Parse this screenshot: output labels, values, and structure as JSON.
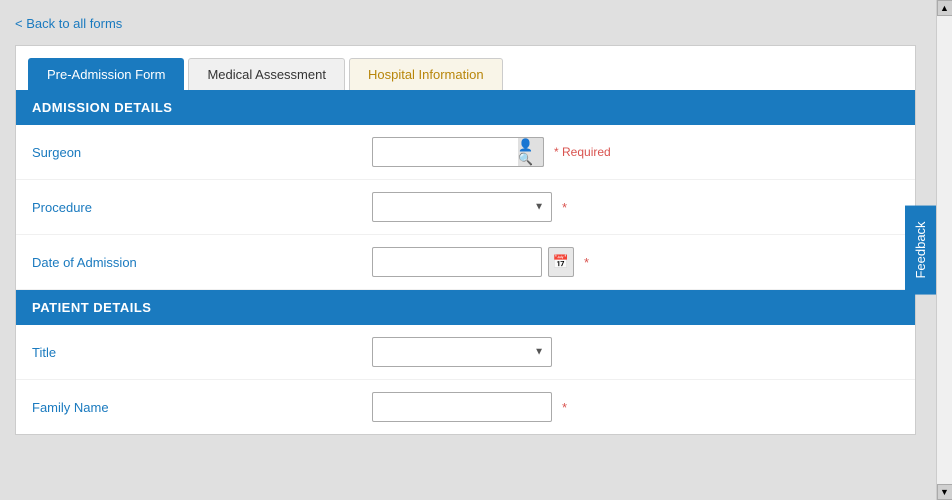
{
  "back_link": "< Back to all forms",
  "tabs": [
    {
      "id": "pre-admission",
      "label": "Pre-Admission Form",
      "active": true,
      "highlight": false
    },
    {
      "id": "medical-assessment",
      "label": "Medical Assessment",
      "active": false,
      "highlight": false
    },
    {
      "id": "hospital-information",
      "label": "Hospital Information",
      "active": false,
      "highlight": true
    }
  ],
  "sections": [
    {
      "id": "admission-details",
      "header": "ADMISSION DETAILS",
      "fields": [
        {
          "id": "surgeon",
          "label": "Surgeon",
          "type": "surgeon-search",
          "value": "",
          "required": true,
          "required_text": "* Required"
        },
        {
          "id": "procedure",
          "label": "Procedure",
          "type": "select",
          "value": "",
          "required": true,
          "options": [
            ""
          ]
        },
        {
          "id": "date-of-admission",
          "label": "Date of Admission",
          "type": "date",
          "value": "",
          "required": true
        }
      ]
    },
    {
      "id": "patient-details",
      "header": "PATIENT DETAILS",
      "fields": [
        {
          "id": "title",
          "label": "Title",
          "type": "select",
          "value": "",
          "required": false,
          "options": [
            ""
          ]
        },
        {
          "id": "family-name",
          "label": "Family Name",
          "type": "text",
          "value": "",
          "required": true
        }
      ]
    }
  ],
  "feedback": {
    "label": "Feedback"
  },
  "icons": {
    "surgeon_search": "🔍",
    "calendar": "📅",
    "dropdown_arrow": "▼",
    "scroll_up": "▲",
    "scroll_down": "▼"
  }
}
